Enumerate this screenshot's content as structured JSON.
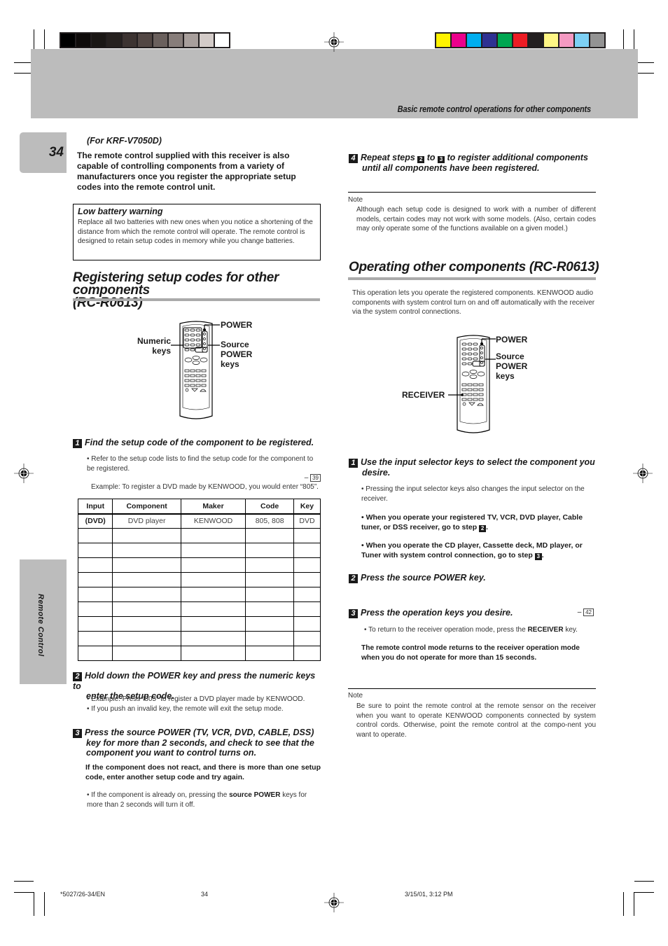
{
  "header": {
    "section_title": "Basic remote control operations for other components",
    "page_number": "34",
    "side_tab_label": "Remote Control"
  },
  "print_marks": {
    "gray_swatches": [
      "#000000",
      "#0e0b0a",
      "#1a1715",
      "#26211f",
      "#3c3331",
      "#524744",
      "#6a605d",
      "#877d7a",
      "#a89f9c",
      "#d3cbc8",
      "#ffffff"
    ],
    "color_swatches": [
      "#fff200",
      "#ec008c",
      "#00aeef",
      "#2e3192",
      "#00a651",
      "#ed1c24",
      "#231f20",
      "#fff685",
      "#f49ac2",
      "#7dd0f4",
      "#939393"
    ]
  },
  "left": {
    "model_note": "(For KRF-V7050D)",
    "intro": "The remote control supplied with this receiver is also capable of controlling components from a variety of manufacturers once you register the appropriate setup codes into the remote control unit.",
    "warning": {
      "title": "Low battery warning",
      "text": "Replace all two batteries with new ones when you notice a shortening of the distance from which the remote control will operate. The remote control is designed to retain setup codes in memory while you change batteries."
    },
    "section_title_line1": "Registering setup codes for other components",
    "section_title_line2": "(RC-R0613)",
    "figure_labels": {
      "power": "POWER",
      "numeric_1": "Numeric",
      "numeric_2": "keys",
      "source_1": "Source",
      "source_2": "POWER",
      "source_3": "keys"
    },
    "step1": {
      "num": "1",
      "title": "Find the setup code of the component to be registered.",
      "bullet": "• Refer to the setup code lists to find the setup code for the component to be registered.",
      "xref": "39",
      "example": "Example: To register a DVD made by KENWOOD, you would enter “805”."
    },
    "table": {
      "headers": [
        "Input",
        "Component",
        "Maker",
        "Code",
        "Key"
      ],
      "rows": [
        [
          "(DVD)",
          "DVD player",
          "KENWOOD",
          "805, 808",
          "DVD"
        ],
        [
          "",
          "",
          "",
          "",
          ""
        ],
        [
          "",
          "",
          "",
          "",
          ""
        ],
        [
          "",
          "",
          "",
          "",
          ""
        ],
        [
          "",
          "",
          "",
          "",
          ""
        ],
        [
          "",
          "",
          "",
          "",
          ""
        ],
        [
          "",
          "",
          "",
          "",
          ""
        ],
        [
          "",
          "",
          "",
          "",
          ""
        ],
        [
          "",
          "",
          "",
          "",
          ""
        ],
        [
          "",
          "",
          "",
          "",
          ""
        ]
      ]
    },
    "step2": {
      "num": "2",
      "title_line1": "Hold down the POWER key and press the numeric keys to",
      "title_line2": "enter the setup code.",
      "bullet1": "• Example: Press “805” to register a DVD player made by KENWOOD.",
      "bullet2": "• If you push an invalid key, the remote will exit the setup mode."
    },
    "step3": {
      "num": "3",
      "title_line1": "Press the source POWER (TV, VCR, DVD, CABLE, DSS)",
      "title_line2": "key for more than 2 seconds, and check to see that the",
      "title_line3": "component you want to control turns on.",
      "bold_note": "If the component does not react, and there is more than one setup code, enter another setup code and try again.",
      "bullet_pre": "• If the component is already on, pressing the ",
      "bullet_bold": "source POWER",
      "bullet_post": " keys for more than 2 seconds will turn it off."
    }
  },
  "right": {
    "step4": {
      "num": "4",
      "title_pre": "Repeat steps ",
      "ref_a": "2",
      "title_mid": " to ",
      "ref_b": "3",
      "title_post": " to register additional components",
      "title_line2": "until all components have been registered."
    },
    "note1": {
      "label": "Note",
      "text": "Although each setup code is designed to work with a number of different models, certain codes may not work with some models. (Also, certain codes may only operate some of the functions available on a given model.)"
    },
    "section_title": "Operating other components (RC-R0613)",
    "intro": "This operation lets you operate the registered components. KENWOOD audio components with system control turn on and off automatically with the receiver via the system control connections.",
    "figure_labels": {
      "power": "POWER",
      "source_1": "Source",
      "source_2": "POWER",
      "source_3": "keys",
      "receiver": "RECEIVER"
    },
    "step1": {
      "num": "1",
      "title_line1": "Use the input selector keys to select the component you",
      "title_line2": "desire.",
      "bullet1": "• Pressing the input selector keys also changes the input selector on the receiver.",
      "bullet2_pre": "• When you operate your registered TV, VCR, DVD player, Cable tuner, or DSS receiver, go to step ",
      "bullet2_ref": "2",
      "bullet3_pre": "• When you operate the CD player, Cassette deck, MD player, or Tuner with system control connection, go to step ",
      "bullet3_ref": "3"
    },
    "step2": {
      "num": "2",
      "title": "Press the source POWER key."
    },
    "step3": {
      "num": "3",
      "title": "Press the operation keys you desire.",
      "xref": "42",
      "bullet_pre": "• To return to the receiver operation mode, press the ",
      "bullet_bold": "RECEIVER",
      "bullet_post": " key.",
      "bold_note": "The remote control mode returns to the receiver operation mode when you do not operate for more than 15 seconds."
    },
    "note2": {
      "label": "Note",
      "text": "Be sure to point the remote control at the remote sensor on the receiver when you want to operate KENWOOD components connected by system control cords. Otherwise, point the remote control at the compo-nent you want to operate."
    }
  },
  "footer": {
    "file_code": "*5027/26-34/EN",
    "page": "34",
    "timestamp": "3/15/01, 3:12 PM"
  }
}
